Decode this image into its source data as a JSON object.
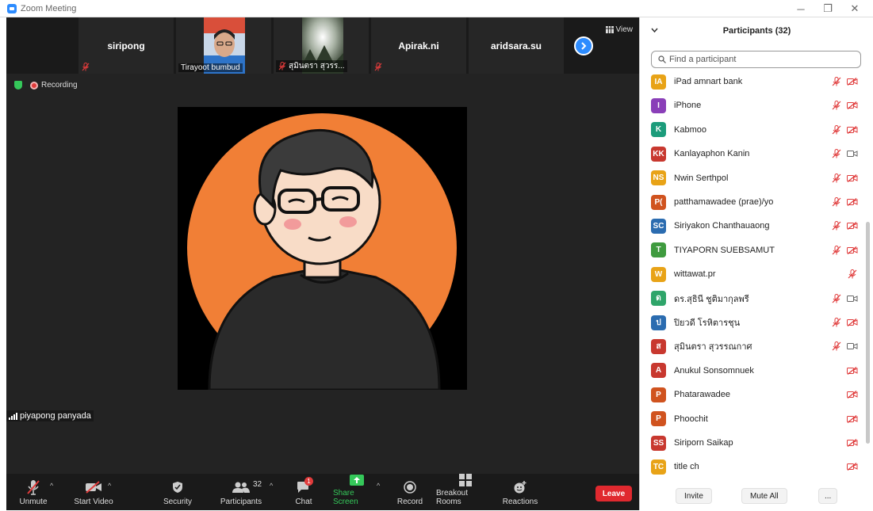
{
  "window": {
    "title": "Zoom Meeting",
    "min": "─",
    "restore": "❐",
    "close": "✕"
  },
  "thumbnails": [
    {
      "name": "siripong",
      "muted": true
    },
    {
      "name": "Tirayoot bumbud",
      "muted": false
    },
    {
      "name": "สุมินตรา สุวรร...",
      "muted": true
    },
    {
      "name": "Apirak.ni",
      "muted": true
    },
    {
      "name": "aridsara.su",
      "muted": false
    }
  ],
  "view": {
    "label": "View"
  },
  "status": {
    "recording": "Recording"
  },
  "speaker": {
    "name": "piyapong panyada"
  },
  "toolbar": {
    "unmute": "Unmute",
    "start_video": "Start Video",
    "security": "Security",
    "participants": "Participants",
    "participants_count": "32",
    "chat": "Chat",
    "chat_badge": "1",
    "share_screen": "Share Screen",
    "record": "Record",
    "breakout_rooms": "Breakout Rooms",
    "reactions": "Reactions",
    "leave": "Leave"
  },
  "panel": {
    "title": "Participants (32)",
    "search_placeholder": "Find a participant",
    "participants": [
      {
        "initials": "IA",
        "name": "iPad amnart  bank",
        "color": "#e8a317",
        "mic": "muted",
        "cam": "off"
      },
      {
        "initials": "I",
        "name": "iPhone",
        "color": "#8a3fb8",
        "mic": "muted",
        "cam": "off"
      },
      {
        "initials": "K",
        "name": "Kabmoo",
        "color": "#1c9c7b",
        "mic": "muted",
        "cam": "off"
      },
      {
        "initials": "KK",
        "name": "Kanlayaphon Kanin",
        "color": "#c8382f",
        "mic": "muted",
        "cam": "on"
      },
      {
        "initials": "NS",
        "name": "Nwin Serthpol",
        "color": "#e8a317",
        "mic": "muted",
        "cam": "off"
      },
      {
        "initials": "P(",
        "name": "patthamawadee (prae)/yo",
        "color": "#d0531f",
        "mic": "muted",
        "cam": "off"
      },
      {
        "initials": "SC",
        "name": "Siriyakon Chanthauaong",
        "color": "#2b6cb0",
        "mic": "muted",
        "cam": "off"
      },
      {
        "initials": "T",
        "name": "TIYAPORN SUEBSAMUT",
        "color": "#3f9b3f",
        "mic": "muted",
        "cam": "off"
      },
      {
        "initials": "W",
        "name": "wittawat.pr",
        "color": "#e8a317",
        "mic": "muted",
        "cam": "none"
      },
      {
        "initials": "ด",
        "name": "ดร.สุธินี ชูติมากุลพรี",
        "color": "#2fa56a",
        "mic": "muted",
        "cam": "on"
      },
      {
        "initials": "ป",
        "name": "ปิยวดี โรหิตารชุน",
        "color": "#2b6cb0",
        "mic": "muted",
        "cam": "off"
      },
      {
        "initials": "ส",
        "name": "สุมินตรา สุวรรณกาศ",
        "color": "#c8382f",
        "mic": "muted",
        "cam": "on"
      },
      {
        "initials": "A",
        "name": "Anukul Sonsomnuek",
        "color": "#c8382f",
        "mic": "none",
        "cam": "off"
      },
      {
        "initials": "P",
        "name": "Phatarawadee",
        "color": "#d0531f",
        "mic": "none",
        "cam": "off"
      },
      {
        "initials": "P",
        "name": "Phoochit",
        "color": "#d0531f",
        "mic": "none",
        "cam": "off"
      },
      {
        "initials": "SS",
        "name": "Siriporn Saikap",
        "color": "#c8382f",
        "mic": "none",
        "cam": "off"
      },
      {
        "initials": "TC",
        "name": "title ch",
        "color": "#e8a317",
        "mic": "none",
        "cam": "off"
      }
    ],
    "invite": "Invite",
    "mute_all": "Mute All",
    "more": "..."
  }
}
